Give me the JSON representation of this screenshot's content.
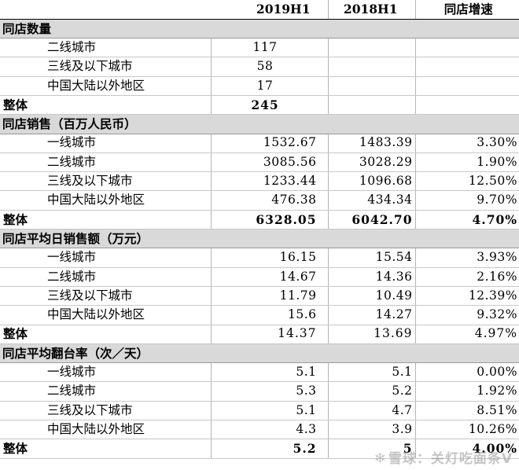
{
  "header": {
    "col1": "2019H1",
    "col2": "2018H1",
    "col3": "同店增速"
  },
  "sections": [
    {
      "title": "同店数量",
      "center": true,
      "rows": [
        {
          "label": "二线城市",
          "v2019": "117",
          "v2018": "",
          "growth": ""
        },
        {
          "label": "三线及以下城市",
          "v2019": "58",
          "v2018": "",
          "growth": ""
        },
        {
          "label": "中国大陆以外地区",
          "v2019": "17",
          "v2018": "",
          "growth": ""
        }
      ],
      "total": {
        "label": "整体",
        "v2019": "245",
        "v2018": "",
        "growth": ""
      }
    },
    {
      "title": "同店销售（百万人民币）",
      "rows": [
        {
          "label": "一线城市",
          "v2019": "1532.67",
          "v2018": "1483.39",
          "growth": "3.30%"
        },
        {
          "label": "二线城市",
          "v2019": "3085.56",
          "v2018": "3028.29",
          "growth": "1.90%"
        },
        {
          "label": "三线及以下城市",
          "v2019": "1233.44",
          "v2018": "1096.68",
          "growth": "12.50%"
        },
        {
          "label": "中国大陆以外地区",
          "v2019": "476.38",
          "v2018": "434.34",
          "growth": "9.70%"
        }
      ],
      "total": {
        "label": "整体",
        "v2019": "6328.05",
        "v2018": "6042.70",
        "growth": "4.70%"
      }
    },
    {
      "title": "同店平均日销售额（万元）",
      "rows": [
        {
          "label": "一线城市",
          "v2019": "16.15",
          "v2018": "15.54",
          "growth": "3.93%"
        },
        {
          "label": "二线城市",
          "v2019": "14.67",
          "v2018": "14.36",
          "growth": "2.16%"
        },
        {
          "label": "三线及以下城市",
          "v2019": "11.79",
          "v2018": "10.49",
          "growth": "12.39%"
        },
        {
          "label": "中国大陆以外地区",
          "v2019": "15.6",
          "v2018": "14.27",
          "growth": "9.32%"
        }
      ],
      "total": {
        "label": "整体",
        "v2019": "14.37",
        "v2018": "13.69",
        "growth": "4.97%",
        "plain": true
      }
    },
    {
      "title": "同店平均翻台率（次／天）",
      "rows": [
        {
          "label": "一线城市",
          "v2019": "5.1",
          "v2018": "5.1",
          "growth": "0.00%"
        },
        {
          "label": "二线城市",
          "v2019": "5.3",
          "v2018": "5.2",
          "growth": "1.92%"
        },
        {
          "label": "三线及以下城市",
          "v2019": "5.1",
          "v2018": "4.7",
          "growth": "8.51%"
        },
        {
          "label": "中国大陆以外地区",
          "v2019": "4.3",
          "v2018": "3.9",
          "growth": "10.26%"
        }
      ],
      "total": {
        "label": "整体",
        "v2019": "5.2",
        "v2018": "5",
        "growth": "4.00%"
      }
    }
  ],
  "watermark": {
    "icon": "snowball-icon",
    "text": "雪球：关灯吃面条Ⅴ"
  }
}
